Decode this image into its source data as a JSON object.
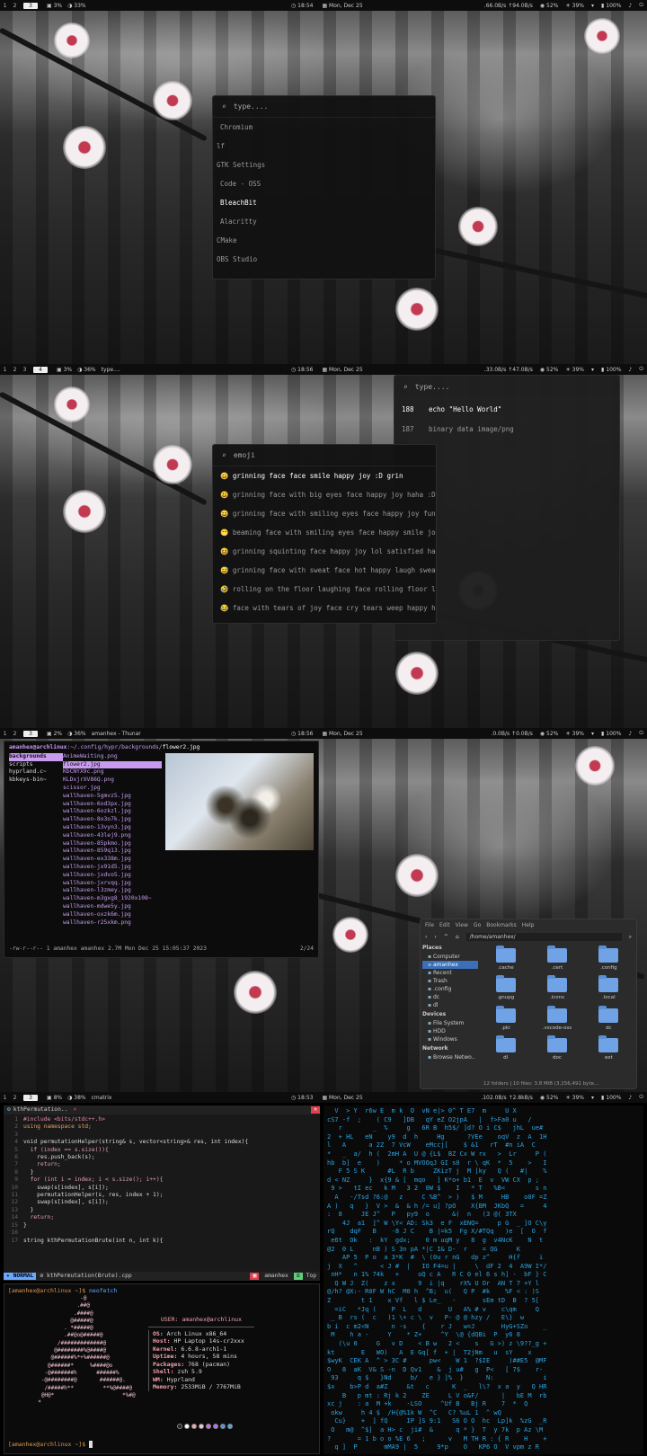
{
  "panel1": {
    "bar": {
      "workspaces": [
        "1",
        "2",
        "3"
      ],
      "active_ws": "3",
      "stats": [
        "3%",
        "33%"
      ],
      "clock": "18:54",
      "date": "Mon, Dec 25",
      "net": ".66.0B/s ↑94.0B/s",
      "cpu": "52%",
      "mem": "39%",
      "battery": "100%"
    },
    "launcher": {
      "placeholder": "type....",
      "items": [
        "Chromium",
        "lf",
        "GTK Settings",
        "Code - OSS",
        "BleachBit",
        "Alacritty",
        "CMake",
        "OBS Studio"
      ],
      "selected": 4
    }
  },
  "panel2": {
    "bar": {
      "workspaces": [
        "1",
        "2",
        "3",
        "4"
      ],
      "active_ws": "4",
      "stats": [
        "3%",
        "36%"
      ],
      "window": "type....",
      "clock": "18:56",
      "date": "Mon, Dec 25",
      "net": ".33.0B/s ↑47.0B/s",
      "cpu": "52%",
      "mem": "39%",
      "battery": "100%"
    },
    "clipboard": {
      "placeholder": "type....",
      "items": [
        {
          "id": "188",
          "text": "echo \"Hello World\""
        },
        {
          "id": "187",
          "text": "binary data image/png"
        }
      ]
    },
    "emoji": {
      "placeholder": "emoji",
      "items": [
        "😀 grinning face face smile happy joy :D grin",
        "😃 grinning face with big eyes face happy joy haha :D :) smi",
        "😄 grinning face with smiling eyes face happy joy funny haha",
        "😁 beaming face with smiling eyes face happy smile joy kawai",
        "😆 grinning squinting face happy joy lol satisfied haha face",
        "😅 grinning face with sweat face hot happy laugh sweat smile",
        "🤣 rolling on the floor laughing face rolling floor laughin",
        "😂 face with tears of joy face cry tears weep happy happytea"
      ]
    }
  },
  "panel3": {
    "bar": {
      "workspaces": [
        "1",
        "2",
        "3"
      ],
      "active_ws": "3",
      "stats": [
        "2%",
        "36%"
      ],
      "window": "amanhex - Thunar",
      "clock": "18:56",
      "date": "Mon, Dec 25",
      "net": ".0.0B/s ↑0.0B/s",
      "cpu": "52%",
      "mem": "39%",
      "battery": "100%"
    },
    "lf": {
      "prompt": "amanhex@archlinux",
      "path": ":~/.config/hypr/backgrounds/",
      "file": "flower2.jpg",
      "dirs": [
        "backgrounds",
        "scripts",
        "hyprland.c~",
        "kbkeys-bin~"
      ],
      "files": [
        "AnimeWaiting.png",
        "flower2.jpg",
        "KbCNYX9c.png",
        "KLDxjrXV86Q.png",
        "scissor.jpg",
        "wallhaven-5gmvz5.jpg",
        "wallhaven-6od3px.jpg",
        "wallhaven-6ozkzl.jpg",
        "wallhaven-8o3o7k.jpg",
        "wallhaven-13vyn3.jpg",
        "wallhaven-43lej9.png",
        "wallhaven-85pkmo.jpg",
        "wallhaven-859q13.jpg",
        "wallhaven-ex338m.jpg",
        "wallhaven-jx91d5.jpg",
        "wallhaven-jxdvo5.jpg",
        "wallhaven-jxrvqq.jpg",
        "wallhaven-l3zmey.jpg",
        "wallhaven-m3gxg8_1920x108~",
        "wallhaven-mdwe5y.jpg",
        "wallhaven-oxzk6m.jpg",
        "wallhaven-r25xkm.png"
      ],
      "status": "-rw-r--r-- 1 amanhex amanhex 2.7M Mon Dec 25 15:05:37 2023",
      "count": "2/24"
    },
    "thunar": {
      "menu": [
        "File",
        "Edit",
        "View",
        "Go",
        "Bookmarks",
        "Help"
      ],
      "path": "/home/amanhex/",
      "places_title": "Places",
      "places": [
        "Computer",
        "amanhex",
        "Recent",
        "Trash",
        ".config",
        "dc",
        "dl"
      ],
      "devices_title": "Devices",
      "devices": [
        "File System",
        "HDD",
        "Windows"
      ],
      "network_title": "Network",
      "network": [
        "Browse Netwo.."
      ],
      "folders": [
        ".cache",
        ".cert",
        ".config",
        ".gnupg",
        ".icons",
        ".local",
        ".pki",
        ".vscode-oss",
        "dc",
        "dl",
        "doc",
        "ext"
      ],
      "status": "12 folders  |  10 files: 3.8 MiB (3,156,491 byte..."
    }
  },
  "panel4": {
    "bar": {
      "workspaces": [
        "1",
        "2",
        "3"
      ],
      "active_ws": "3",
      "stats": [
        "8%",
        "38%"
      ],
      "window": "cmatrix",
      "clock": "18:53",
      "date": "Mon, Dec 25",
      "net": ".102.0B/s ↑2.8kB/s",
      "cpu": "52%",
      "mem": "39%",
      "battery": "100%"
    },
    "editor": {
      "tab": "kthPermutation..",
      "mode": "NORMAL",
      "file": "kthPermutation(Brute).cpp",
      "user": "amanhex",
      "pos": "Top",
      "lines": [
        "#include <bits/stdc++.h>",
        "using namespace std;",
        "",
        "void permutationHelper(string& s, vector<string>& res, int index){",
        "  if (index == s.size()){",
        "    res.push_back(s);",
        "    return;",
        "  }",
        "  for (int i = index; i < s.size(); i++){",
        "    swap(s[index], s[i]);",
        "    permutationHelper(s, res, index + 1);",
        "    swap(s[index], s[i]);",
        "  }",
        "  return;",
        "}",
        "",
        "string kthPermutationBrute(int n, int k){"
      ]
    },
    "neofetch": {
      "prompt": "[amanhex@archlinux ~]$",
      "cmd": "neofetch",
      "user_line": "USER: amanhex@archlinux",
      "info": [
        [
          "OS:",
          "Arch Linux x86_64"
        ],
        [
          "Host:",
          "HP Laptop 14s-cr2xxx"
        ],
        [
          "Kernel:",
          "6.6.8-arch1-1"
        ],
        [
          "Uptime:",
          "4 hours, 58 mins"
        ],
        [
          "Packages:",
          "768 (pacman)"
        ],
        [
          "Shell:",
          "zsh 5.9"
        ],
        [
          "WM:",
          "Hyprland"
        ],
        [
          "Memory:",
          "2533MiB / 7767MiB"
        ]
      ]
    },
    "colors": [
      "#222222",
      "#ffffff",
      "#f4a6b5",
      "#f0c5e0",
      "#d070e0",
      "#b070f0",
      "#5c8cf0",
      "#4aa8f0"
    ]
  }
}
